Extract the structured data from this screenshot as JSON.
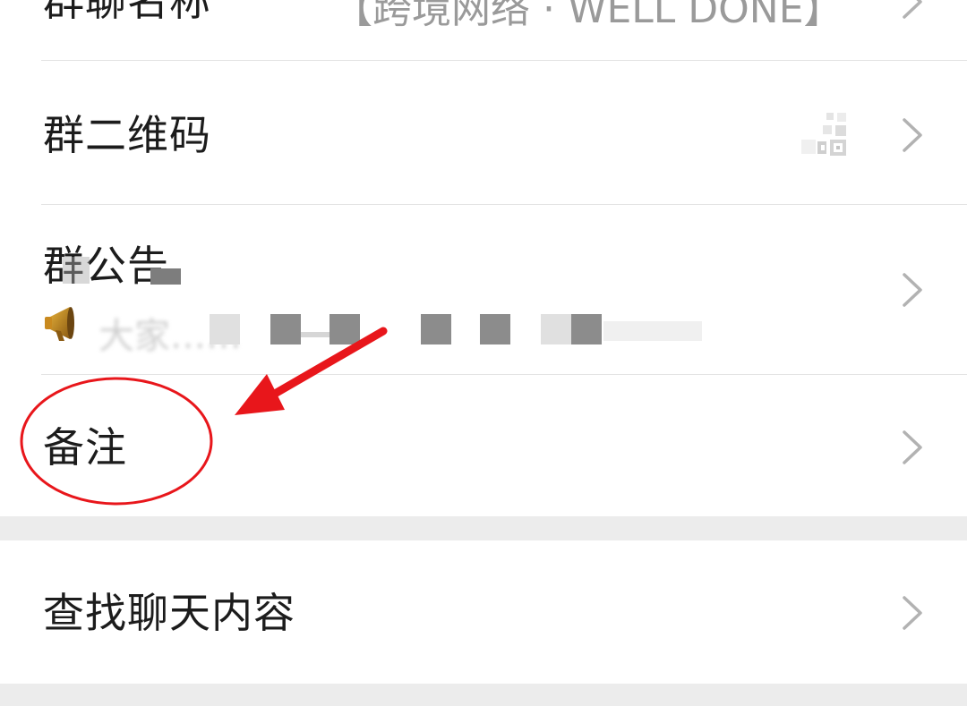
{
  "group_name": {
    "label": "群聊名称",
    "value": "【跨境网络 · WELL DONE】"
  },
  "group_qr": {
    "label": "群二维码"
  },
  "group_notice": {
    "label": "群公告",
    "preview": "大家……"
  },
  "remark": {
    "label": "备注"
  },
  "search_chat": {
    "label": "查找聊天内容"
  },
  "colors": {
    "annotation": "#e8161b",
    "text": "#1c1c1c",
    "chevron": "#b2b2b2",
    "separator": "#ececec"
  },
  "icons": {
    "row_chevron": "chevron-right-icon",
    "notice": "megaphone-icon",
    "qr": "qr-code-icon"
  }
}
